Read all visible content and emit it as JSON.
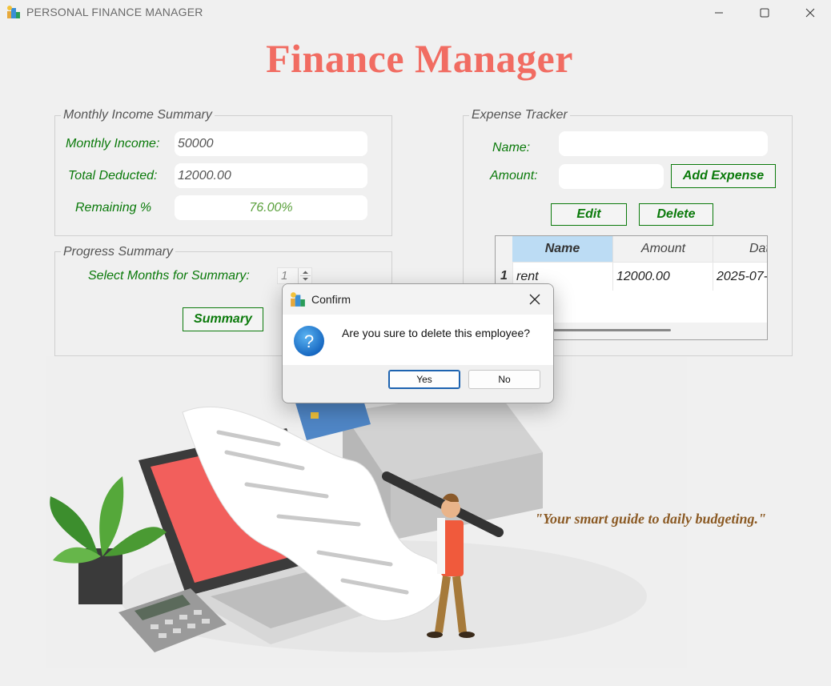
{
  "window": {
    "title": "PERSONAL FINANCE MANAGER",
    "minimize_icon": "minimize-icon",
    "maximize_icon": "maximize-icon",
    "close_icon": "close-icon"
  },
  "heading": "Finance Manager",
  "income": {
    "legend": "Monthly Income Summary",
    "monthly_income_label": "Monthly Income:",
    "monthly_income_value": "50000",
    "total_deducted_label": "Total Deducted:",
    "total_deducted_value": "12000.00",
    "remaining_label": "Remaining %",
    "remaining_value": "76.00%"
  },
  "progress": {
    "legend": "Progress Summary",
    "select_months_label": "Select Months for Summary:",
    "months_value": "1",
    "summary_button": "Summary"
  },
  "expense": {
    "legend": "Expense Tracker",
    "name_label": "Name:",
    "name_value": "",
    "amount_label": "Amount:",
    "amount_value": "",
    "add_button": "Add Expense",
    "edit_button": "Edit",
    "delete_button": "Delete",
    "table": {
      "columns": [
        "Name",
        "Amount",
        "Date"
      ],
      "rows": [
        {
          "index": "1",
          "name": "rent",
          "amount": "12000.00",
          "date": "2025-07-"
        }
      ]
    }
  },
  "dialog": {
    "title": "Confirm",
    "message": "Are you sure to delete this employee?",
    "yes_button": "Yes",
    "no_button": "No",
    "icon": "question-icon"
  },
  "quote": "\"Your smart guide to daily budgeting.\"",
  "colors": {
    "heading": "#f16c62",
    "label_green": "#0b7a0b",
    "quote_brown": "#8b5a24",
    "remaining_green": "#5aa03c",
    "header_selected": "#bcdcf4",
    "dialog_icon": "#1e7fd6"
  }
}
